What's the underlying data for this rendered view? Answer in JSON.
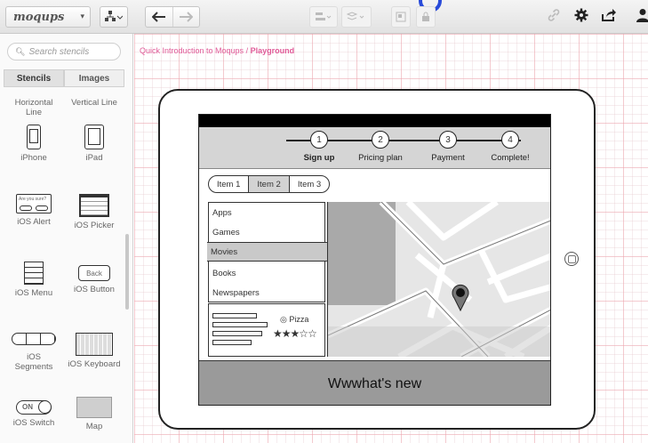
{
  "toolbar": {
    "logo": "moqups",
    "logo_caret": "▾",
    "shapes_icon": "shapes-icon",
    "undo_icon": "undo-arrow-icon",
    "redo_icon": "redo-arrow-icon",
    "link_icon": "link-icon",
    "settings_icon": "gear-icon",
    "share_icon": "share-icon",
    "user_icon": "user-icon"
  },
  "sidebar": {
    "search_placeholder": "Search stencils",
    "tabs": [
      {
        "label": "Stencils",
        "active": true
      },
      {
        "label": "Images",
        "active": false
      }
    ],
    "stencils": [
      {
        "label": "Horizontal Line"
      },
      {
        "label": "Vertical Line"
      },
      {
        "label": "iPhone"
      },
      {
        "label": "iPad"
      },
      {
        "label": "iOS Alert",
        "thumb_text": "Are you sure?"
      },
      {
        "label": "iOS Picker"
      },
      {
        "label": "iOS Menu"
      },
      {
        "label": "iOS Button",
        "thumb_text": "Back"
      },
      {
        "label": "iOS Segments"
      },
      {
        "label": "iOS Keyboard"
      },
      {
        "label": "iOS Switch",
        "thumb_text": "ON"
      },
      {
        "label": "Map"
      }
    ]
  },
  "canvas": {
    "breadcrumb_parent": "Quick Introduction to Moqups",
    "breadcrumb_sep": " / ",
    "breadcrumb_current": "Playground"
  },
  "mockup": {
    "wizard_steps": [
      {
        "num": "1",
        "label": "Sign up",
        "bold": true
      },
      {
        "num": "2",
        "label": "Pricing plan",
        "bold": false
      },
      {
        "num": "3",
        "label": "Payment",
        "bold": false
      },
      {
        "num": "4",
        "label": "Complete!",
        "bold": false
      }
    ],
    "segments": [
      {
        "label": "Item 1",
        "selected": false
      },
      {
        "label": "Item 2",
        "selected": true
      },
      {
        "label": "Item 3",
        "selected": false
      }
    ],
    "menu_items": [
      {
        "label": "Apps",
        "active": false
      },
      {
        "label": "Games",
        "active": false
      },
      {
        "label": "Movies",
        "active": true
      },
      {
        "label": "Books",
        "active": false
      },
      {
        "label": "Newspapers",
        "active": false
      }
    ],
    "pizza_label": "Pizza",
    "rating": 3,
    "rating_max": 5,
    "footer": "Wwwhat's new"
  }
}
